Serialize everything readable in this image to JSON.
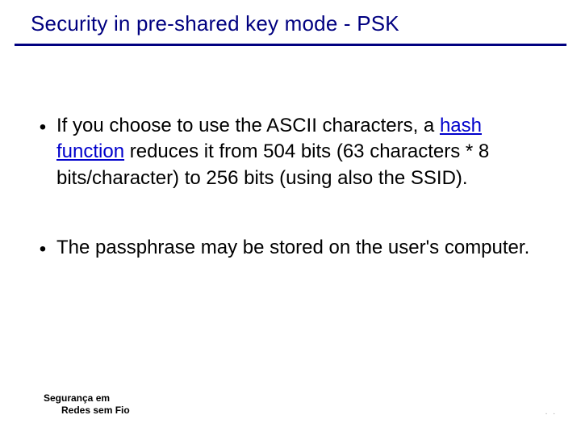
{
  "title": "Security in pre-shared key mode - PSK",
  "bullets": [
    {
      "pre": "If you choose to use the ASCII characters, a ",
      "link": "hash function",
      "post": " reduces it from 504 bits (63 characters * 8 bits/character) to 256 bits (using also the SSID)."
    },
    {
      "pre": "The passphrase may be stored on the user's computer.",
      "link": "",
      "post": ""
    }
  ],
  "footer": {
    "line1": "Segurança em",
    "line2": "Redes sem Fio"
  },
  "pagecorner": ". ."
}
